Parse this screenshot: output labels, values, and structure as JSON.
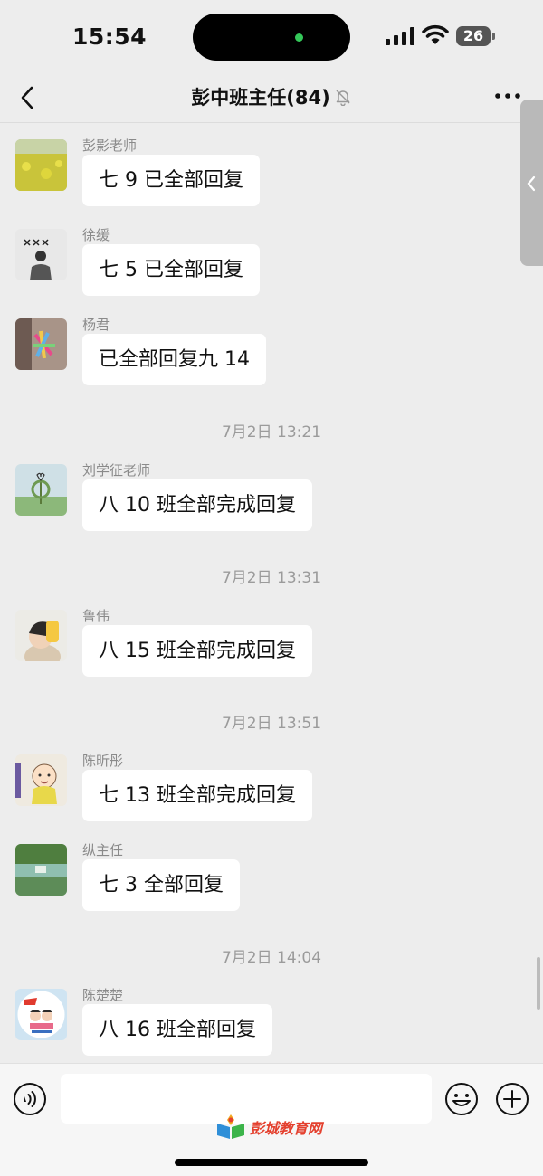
{
  "status_bar": {
    "time": "15:54",
    "battery": "26"
  },
  "header": {
    "title": "彭中班主任(84)"
  },
  "messages": [
    {
      "sender": "彭影老师",
      "text": "七 9 已全部回复"
    },
    {
      "sender": "徐缓",
      "text": "七 5 已全部回复"
    },
    {
      "sender": "杨君",
      "text": "已全部回复九 14"
    },
    {
      "sender": "刘学征老师",
      "text": "八 10 班全部完成回复"
    },
    {
      "sender": "鲁伟",
      "text": "八 15 班全部完成回复"
    },
    {
      "sender": "陈昕彤",
      "text": "七 13 班全部完成回复"
    },
    {
      "sender": "纵主任",
      "text": "七 3 全部回复"
    },
    {
      "sender": "陈楚楚",
      "text": "八 16 班全部回复"
    }
  ],
  "timestamps": [
    "7月2日 13:21",
    "7月2日 13:31",
    "7月2日 13:51",
    "7月2日 14:04"
  ],
  "input": {
    "value": "",
    "placeholder": ""
  },
  "watermark": {
    "text": "彭城教育网"
  },
  "colors": {
    "background": "#ededed",
    "bubble": "#ffffff",
    "accent": "#e4402e"
  }
}
